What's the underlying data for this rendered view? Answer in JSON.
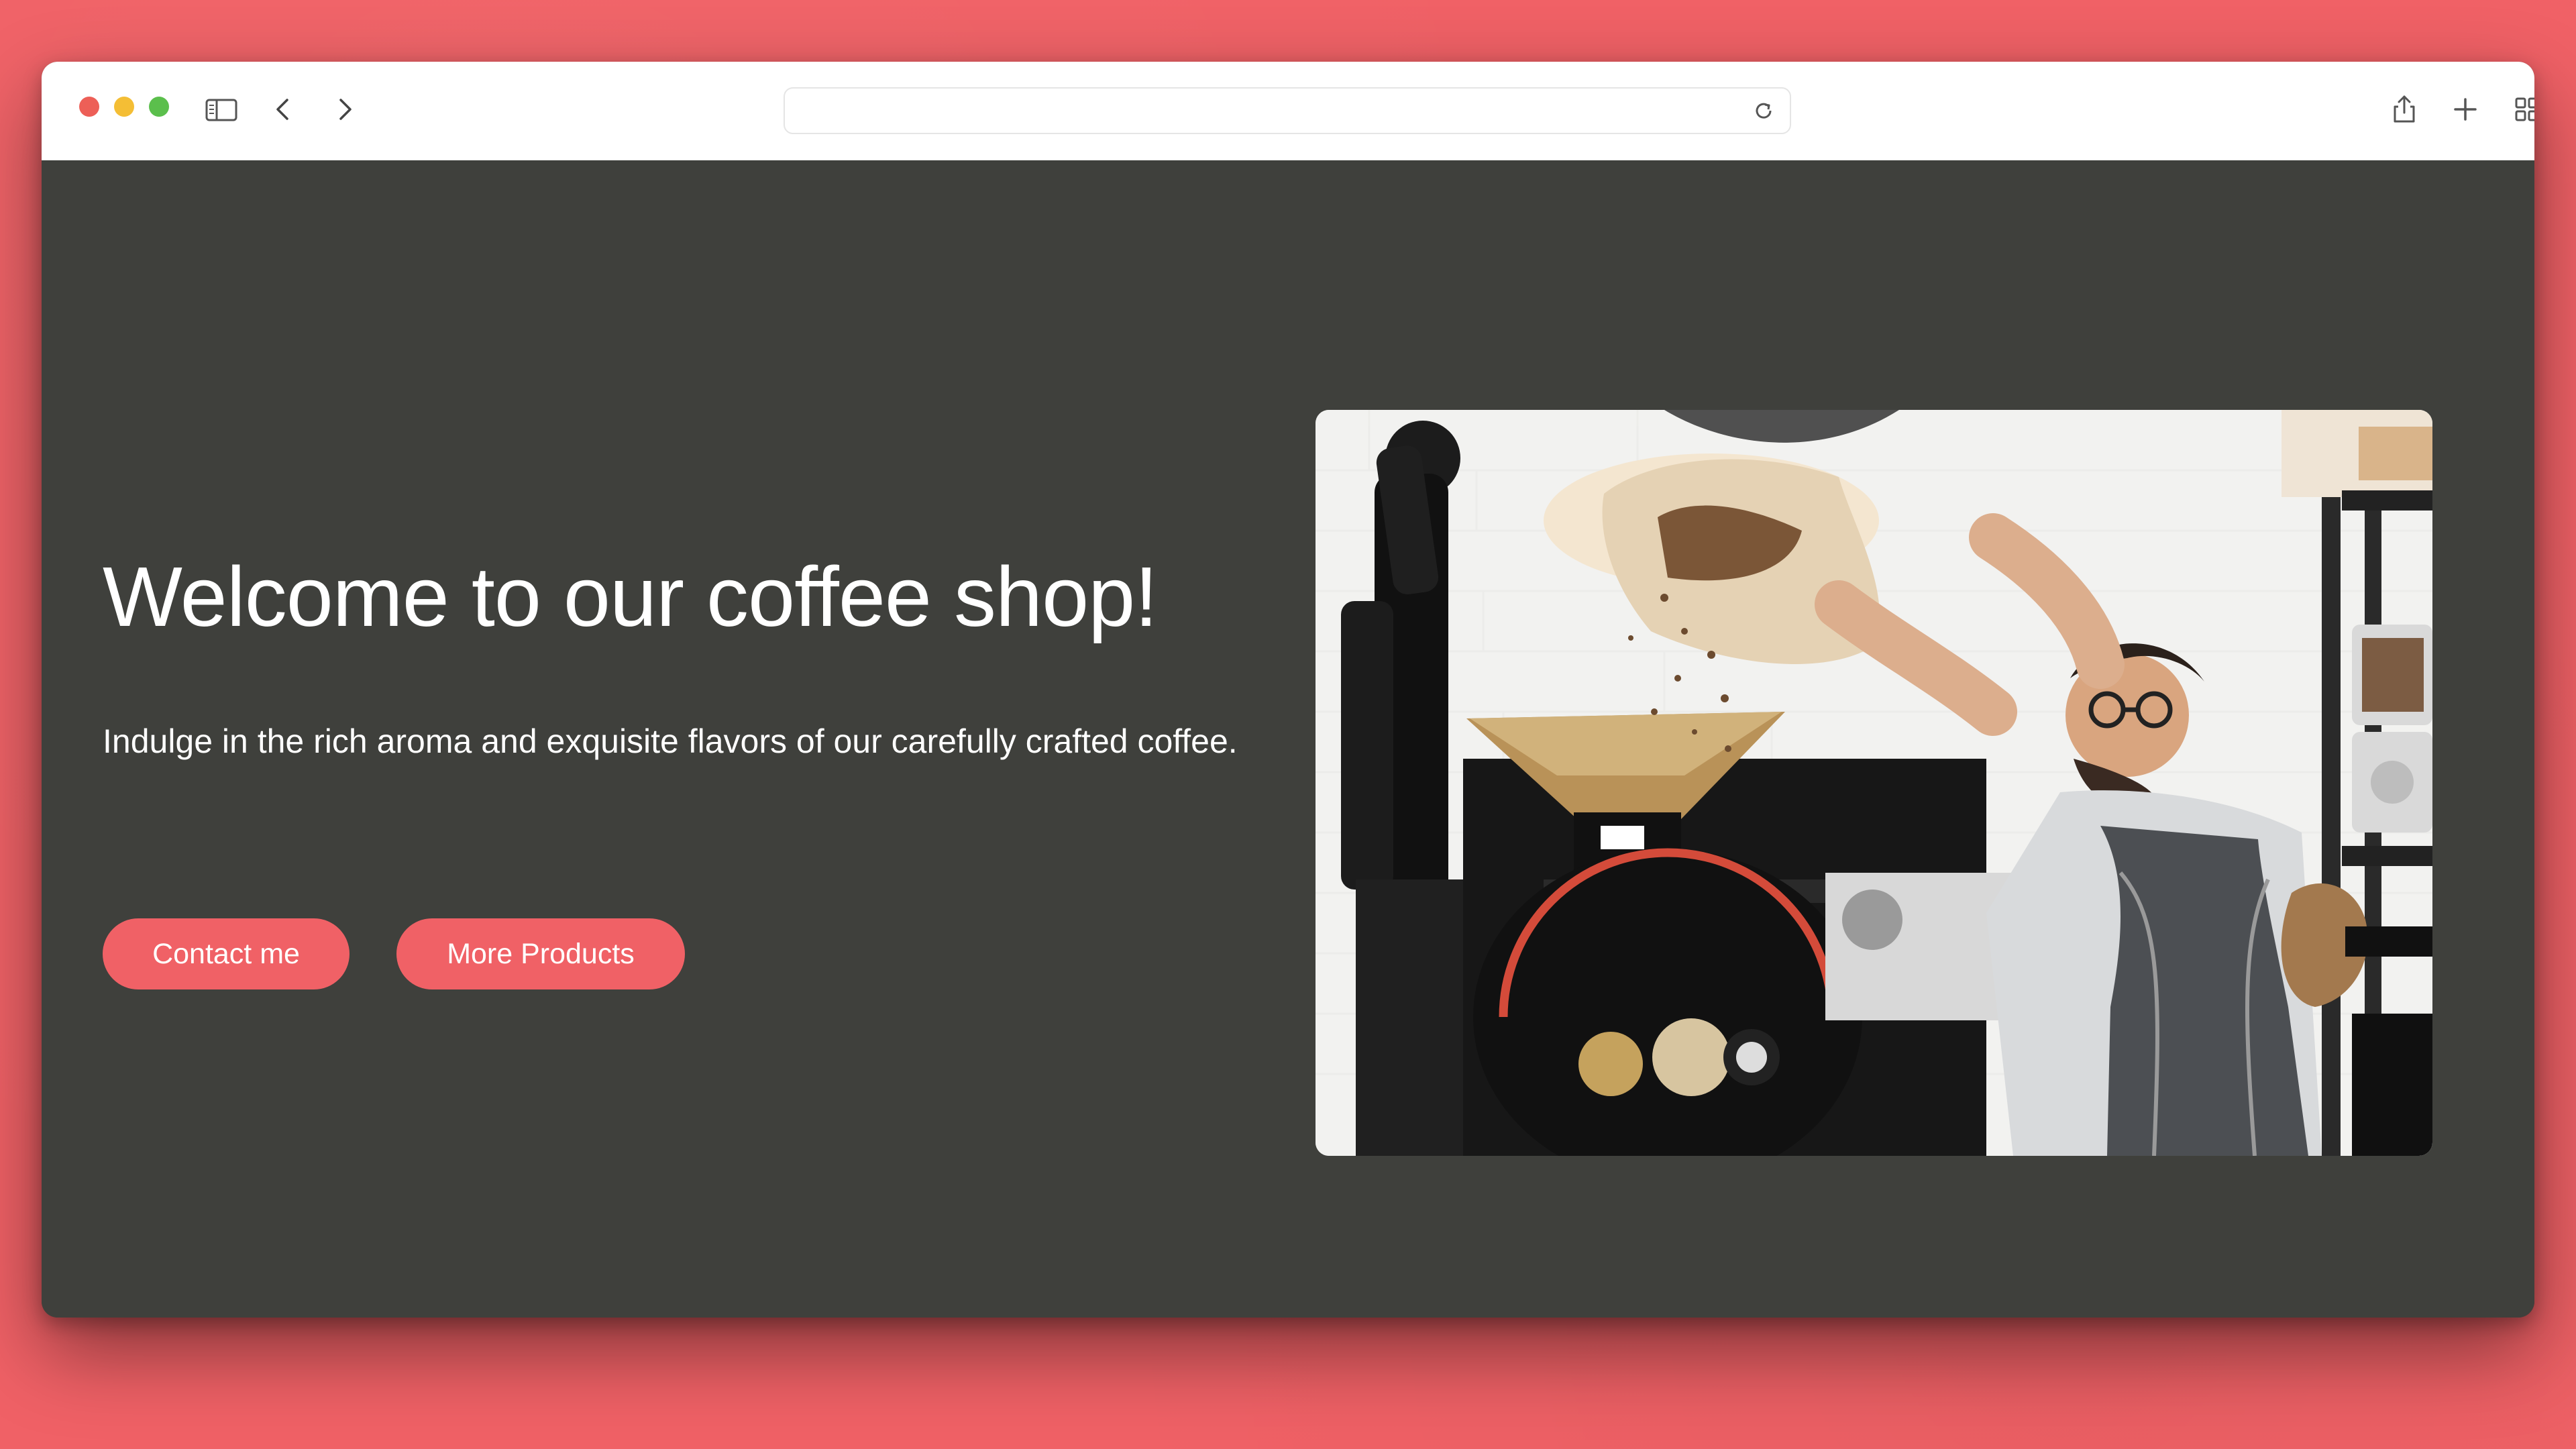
{
  "browser": {
    "toolbar_icons": [
      "sidebar-toggle-icon",
      "back-arrow-icon",
      "forward-arrow-icon",
      "reload-icon",
      "share-icon",
      "new-tab-icon",
      "tabs-overview-icon"
    ],
    "address_value": ""
  },
  "hero": {
    "title": "Welcome to our coffee shop!",
    "subtitle": "Indulge in the rich aroma and exquisite flavors of our carefully crafted coffee.",
    "contact_button": "Contact me",
    "products_button": "More Products"
  },
  "colors": {
    "backdrop": "#f06166",
    "page_background": "#3f403c",
    "accent": "#f06166",
    "toolbar": "#ffffff"
  }
}
